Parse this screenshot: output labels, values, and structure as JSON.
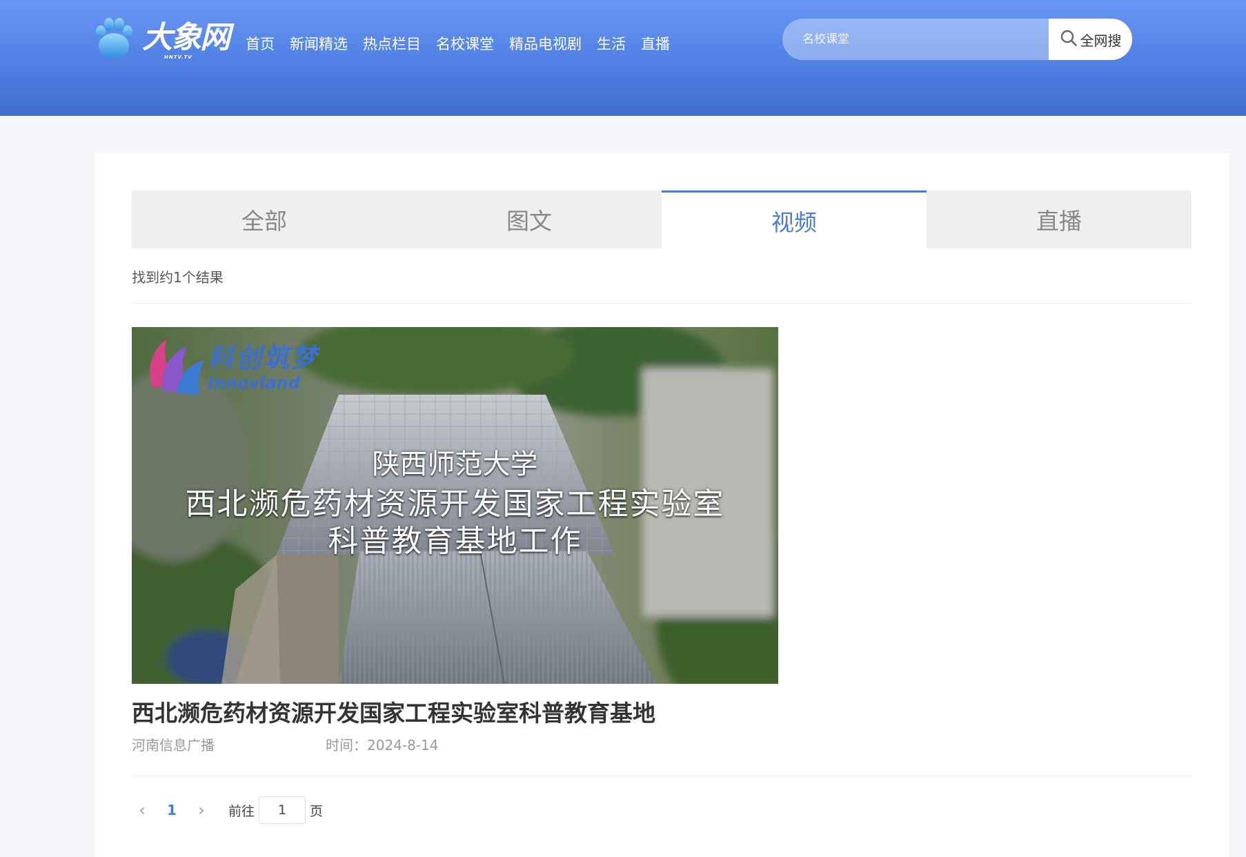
{
  "header": {
    "logo_text": "大象网",
    "logo_sub": "HNTV.TV",
    "nav": [
      "首页",
      "新闻精选",
      "热点栏目",
      "名校课堂",
      "精品电视剧",
      "生活",
      "直播"
    ],
    "search": {
      "placeholder": "名校课堂",
      "button_label": "全网搜"
    }
  },
  "tabs": [
    {
      "label": "全部",
      "active": false
    },
    {
      "label": "图文",
      "active": false
    },
    {
      "label": "视频",
      "active": true
    },
    {
      "label": "直播",
      "active": false
    }
  ],
  "results": {
    "count_text": "找到约1个结果",
    "items": [
      {
        "thumb": {
          "brand_cn": "科创筑梦",
          "brand_en": "Innovland",
          "caption_lines": [
            "陕西师范大学",
            "西北濒危药材资源开发国家工程实验室",
            "科普教育基地工作"
          ]
        },
        "title": "西北濒危药材资源开发国家工程实验室科普教育基地",
        "source": "河南信息广播",
        "time": "时间：2024-8-14"
      }
    ]
  },
  "pagination": {
    "prev": "‹",
    "current_page": "1",
    "next": "›",
    "goto_label": "前往",
    "goto_value": "1",
    "unit_label": "页"
  },
  "colors": {
    "header_top": "#6a97f6",
    "header_bottom": "#3f6fce",
    "accent": "#4a7bd6"
  }
}
